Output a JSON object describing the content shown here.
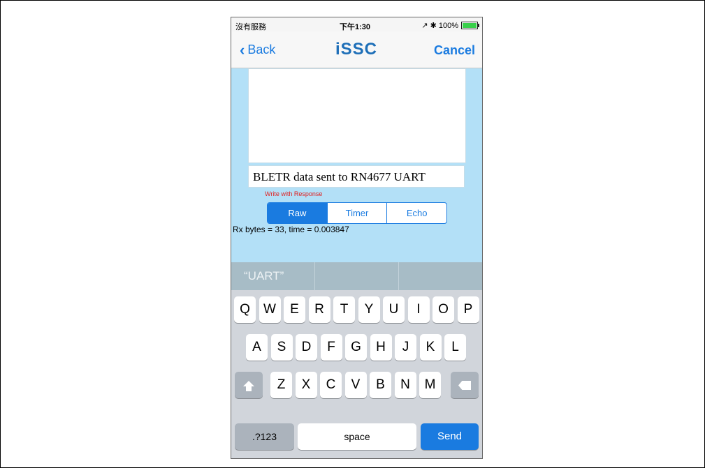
{
  "status": {
    "carrier": "沒有服務",
    "time": "下午1:30",
    "indicators": "↗ ✱ 100%",
    "battery_color": "#38d04a"
  },
  "nav": {
    "back_label": "Back",
    "logo": "iSSC",
    "cancel_label": "Cancel",
    "accent": "#1a7be0"
  },
  "input": {
    "value": "BLETR data sent to RN4677 UART"
  },
  "write_mode": "Write with Response",
  "segments": [
    {
      "label": "Raw",
      "selected": true
    },
    {
      "label": "Timer",
      "selected": false
    },
    {
      "label": "Echo",
      "selected": false
    }
  ],
  "rx_status": "Rx bytes = 33, time = 0.003847",
  "suggestions": [
    "“UART”",
    "",
    ""
  ],
  "keyboard": {
    "row1": [
      "Q",
      "W",
      "E",
      "R",
      "T",
      "Y",
      "U",
      "I",
      "O",
      "P"
    ],
    "row2": [
      "A",
      "S",
      "D",
      "F",
      "G",
      "H",
      "J",
      "K",
      "L"
    ],
    "row3": [
      "Z",
      "X",
      "C",
      "V",
      "B",
      "N",
      "M"
    ],
    "numbers_label": ".?123",
    "space_label": "space",
    "send_label": "Send",
    "shift_icon": "shift-icon",
    "delete_icon": "delete-icon"
  }
}
